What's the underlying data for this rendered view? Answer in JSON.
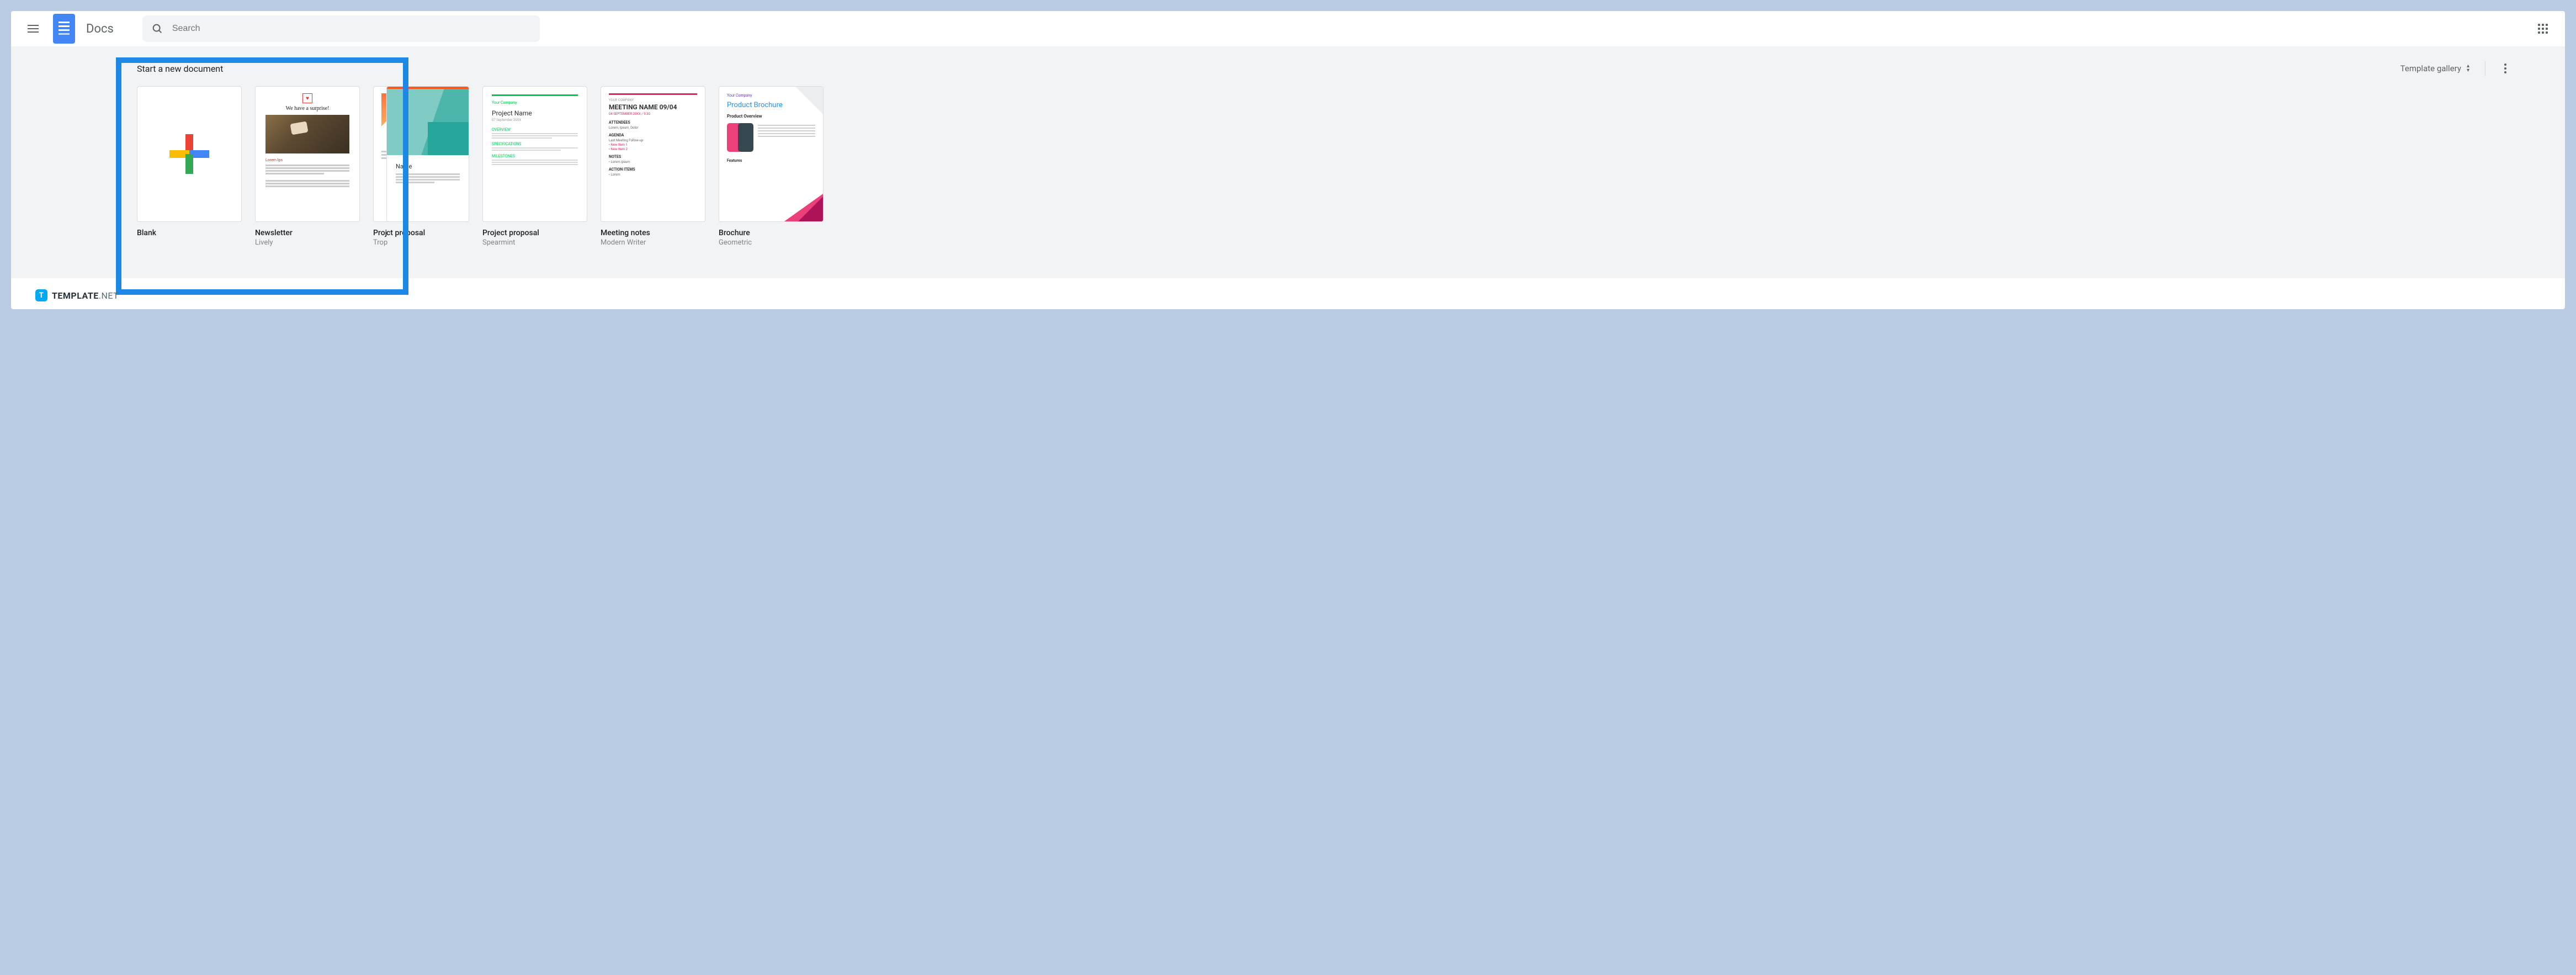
{
  "header": {
    "app_title": "Docs",
    "search_placeholder": "Search"
  },
  "section": {
    "title": "Start a new document",
    "gallery_label": "Template gallery"
  },
  "templates": [
    {
      "label": "Blank",
      "sublabel": ""
    },
    {
      "label": "Newsletter",
      "sublabel": "Lively"
    },
    {
      "label": "Proj",
      "sublabel": "Trop"
    },
    {
      "label": "ct proposal",
      "sublabel": ""
    },
    {
      "label": "Project proposal",
      "sublabel": "Spearmint"
    },
    {
      "label": "Meeting notes",
      "sublabel": "Modern Writer"
    },
    {
      "label": "Brochure",
      "sublabel": "Geometric"
    }
  ],
  "thumbs": {
    "newsletter_heading": "We have a surprise!",
    "proposal1_title": "Name",
    "proposal2_title": "Project Name",
    "meeting_title": "MEETING NAME 09/04",
    "brochure_title": "Product Brochure",
    "brochure_sub": "Product Overview"
  },
  "watermark": {
    "badge": "T",
    "brand": "TEMPLATE",
    "suffix": ".NET"
  }
}
